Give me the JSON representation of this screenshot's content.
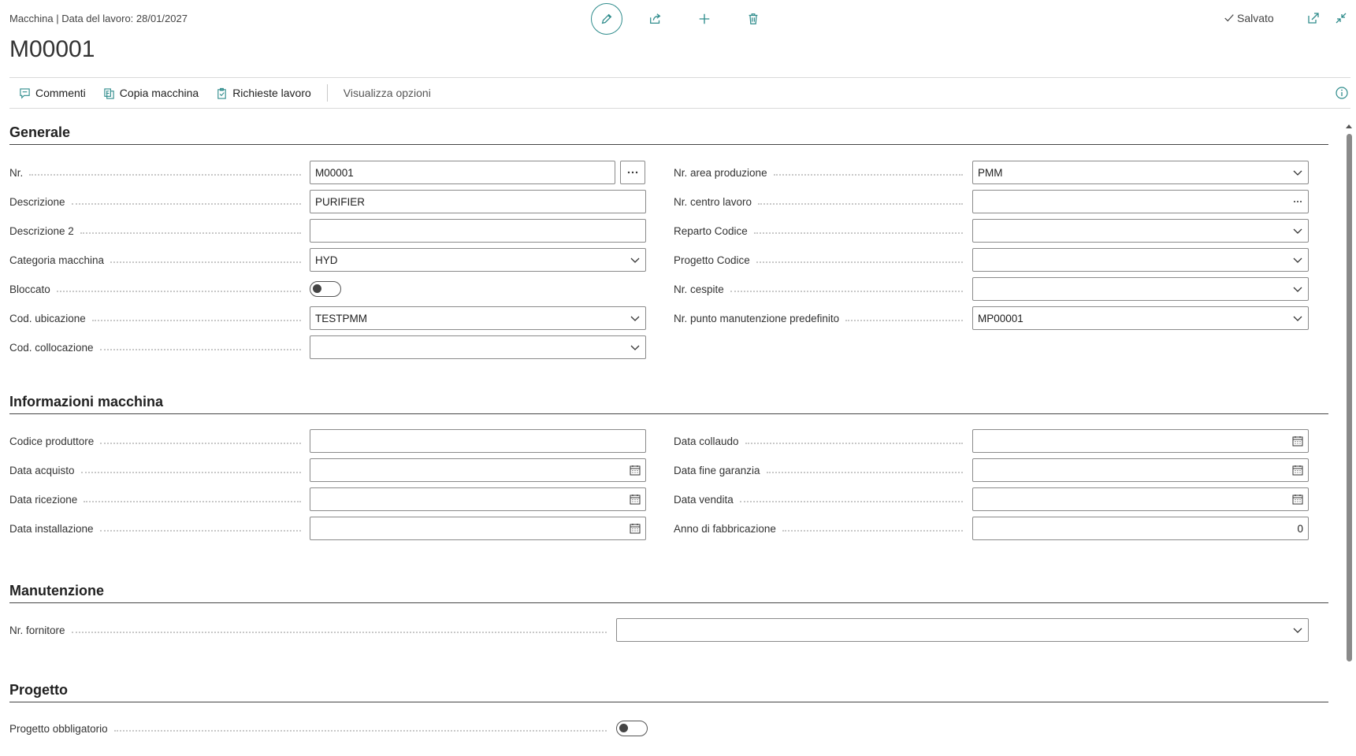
{
  "header": {
    "breadcrumb": "Macchina | Data del lavoro: 28/01/2027",
    "title": "M00001",
    "saved_label": "Salvato"
  },
  "actions": {
    "comments": "Commenti",
    "copy_machine": "Copia macchina",
    "work_requests": "Richieste lavoro",
    "view_options": "Visualizza opzioni"
  },
  "sections": {
    "generale": {
      "title": "Generale",
      "nr_label": "Nr.",
      "nr_value": "M00001",
      "descrizione_label": "Descrizione",
      "descrizione_value": "PURIFIER",
      "descrizione2_label": "Descrizione 2",
      "descrizione2_value": "",
      "categoria_label": "Categoria macchina",
      "categoria_value": "HYD",
      "bloccato_label": "Bloccato",
      "bloccato_value": false,
      "ubicazione_label": "Cod. ubicazione",
      "ubicazione_value": "TESTPMM",
      "collocazione_label": "Cod. collocazione",
      "collocazione_value": "",
      "area_label": "Nr. area produzione",
      "area_value": "PMM",
      "centro_label": "Nr. centro lavoro",
      "centro_value": "",
      "reparto_label": "Reparto Codice",
      "reparto_value": "",
      "progetto_label": "Progetto Codice",
      "progetto_value": "",
      "cespite_label": "Nr. cespite",
      "cespite_value": "",
      "punto_label": "Nr. punto manutenzione predefinito",
      "punto_value": "MP00001"
    },
    "informazioni": {
      "title": "Informazioni macchina",
      "produttore_label": "Codice produttore",
      "produttore_value": "",
      "acquisto_label": "Data acquisto",
      "acquisto_value": "",
      "ricezione_label": "Data ricezione",
      "ricezione_value": "",
      "installazione_label": "Data installazione",
      "installazione_value": "",
      "collaudo_label": "Data collaudo",
      "collaudo_value": "",
      "garanzia_label": "Data fine garanzia",
      "garanzia_value": "",
      "vendita_label": "Data vendita",
      "vendita_value": "",
      "anno_label": "Anno di fabbricazione",
      "anno_value": "0"
    },
    "manutenzione": {
      "title": "Manutenzione",
      "fornitore_label": "Nr. fornitore",
      "fornitore_value": ""
    },
    "progetto": {
      "title": "Progetto",
      "obbligatorio_label": "Progetto obbligatorio",
      "obbligatorio_value": false
    }
  },
  "colors": {
    "accent": "#2f8c8c",
    "text": "#212121",
    "border": "#8a8a8a"
  }
}
